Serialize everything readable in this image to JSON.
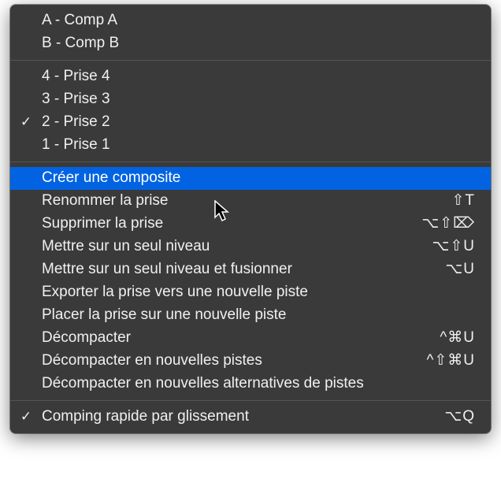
{
  "comps": [
    {
      "label": "A - Comp A",
      "checked": false
    },
    {
      "label": "B - Comp B",
      "checked": false
    }
  ],
  "takes": [
    {
      "label": "4 - Prise 4",
      "checked": false
    },
    {
      "label": "3 - Prise 3",
      "checked": false
    },
    {
      "label": "2 - Prise 2",
      "checked": true
    },
    {
      "label": "1 - Prise 1",
      "checked": false
    }
  ],
  "actions": [
    {
      "label": "Créer une composite",
      "shortcut": "",
      "highlight": true
    },
    {
      "label": "Renommer la prise",
      "shortcut": "⇧T",
      "highlight": false
    },
    {
      "label": "Supprimer la prise",
      "shortcut": "⌥⇧⌦",
      "highlight": false
    },
    {
      "label": "Mettre sur un seul niveau",
      "shortcut": "⌥⇧U",
      "highlight": false
    },
    {
      "label": "Mettre sur un seul niveau et fusionner",
      "shortcut": "⌥U",
      "highlight": false
    },
    {
      "label": "Exporter la prise vers une nouvelle piste",
      "shortcut": "",
      "highlight": false
    },
    {
      "label": "Placer la prise sur une nouvelle piste",
      "shortcut": "",
      "highlight": false
    },
    {
      "label": "Décompacter",
      "shortcut": "^⌘U",
      "highlight": false
    },
    {
      "label": "Décompacter en nouvelles pistes",
      "shortcut": "^⇧⌘U",
      "highlight": false
    },
    {
      "label": "Décompacter en nouvelles alternatives de pistes",
      "shortcut": "",
      "highlight": false
    }
  ],
  "footer": [
    {
      "label": "Comping rapide par glissement",
      "shortcut": "⌥Q",
      "checked": true
    }
  ],
  "checkmark_glyph": "✓"
}
